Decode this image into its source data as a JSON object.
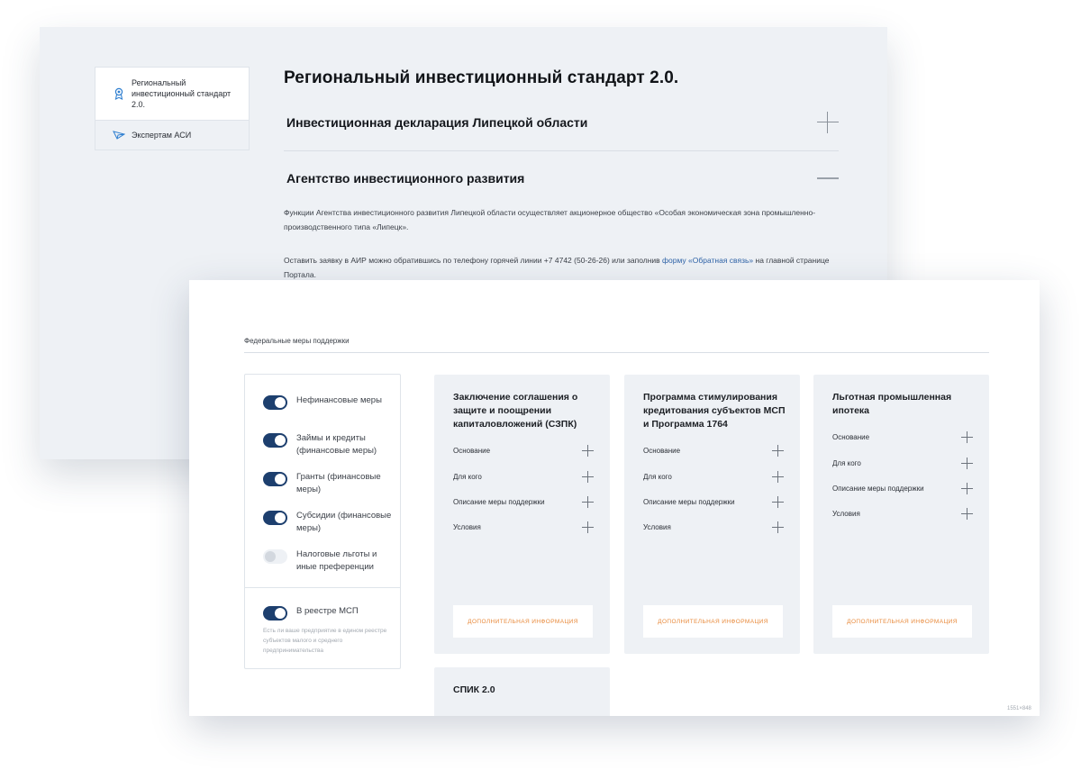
{
  "back_window": {
    "sidebar": {
      "items": [
        {
          "label": "Региональный инвестиционный стандарт 2.0.",
          "icon": "award-icon"
        },
        {
          "label": "Экспертам АСИ",
          "icon": "send-icon"
        }
      ]
    },
    "title": "Региональный инвестиционный стандарт 2.0.",
    "accordion": [
      {
        "label": "Инвестиционная декларация Липецкой области",
        "state": "collapsed"
      },
      {
        "label": "Агентство инвестиционного развития",
        "state": "expanded"
      }
    ],
    "paragraph1": "Функции Агентства инвестиционного развития Липецкой области осуществляет акционерное общество «Особая экономическая зона промышленно-производственного типа «Липецк».",
    "paragraph2": {
      "before": "Оставить заявку в АИР можно обратившись по телефону горячей линии +7 4742 (50-26-26) или заполнив ",
      "link": "форму «Обратная связь»",
      "after": " на главной странице Портала."
    }
  },
  "front_window": {
    "section_label": "Федеральные меры поддержки",
    "filters": [
      {
        "label": "Нефинансовые меры",
        "on": true
      },
      {
        "label": "Займы и кредиты (финансовые меры)",
        "on": true
      },
      {
        "label": "Гранты (финансовые меры)",
        "on": true
      },
      {
        "label": "Субсидии (финансовые меры)",
        "on": true
      },
      {
        "label": "Налоговые льготы и иные преференции",
        "on": false
      }
    ],
    "registry_filter": {
      "label": "В реестре МСП",
      "on": true
    },
    "registry_help": "Есть ли ваше предприятие в едином реестре субъектов малого и среднего предпринимательства",
    "cards": [
      {
        "title": "Заключение соглашения о защите и поощрении капиталовложений (СЗПК)",
        "rows": [
          "Основание",
          "Для кого",
          "Описание меры поддержки",
          "Условия"
        ],
        "button": "Дополнительная информация"
      },
      {
        "title": "Программа стимулирования кредитования субъектов МСП и Программа 1764",
        "rows": [
          "Основание",
          "Для кого",
          "Описание меры поддержки",
          "Условия"
        ],
        "button": "Дополнительная информация"
      },
      {
        "title": "Льготная промышленная ипотека",
        "rows": [
          "Основание",
          "Для кого",
          "Описание меры поддержки",
          "Условия"
        ],
        "button": "Дополнительная информация"
      },
      {
        "title": "СПИК 2.0"
      }
    ],
    "dimensions_note": "1551×848"
  },
  "colors": {
    "accent_dark": "#1d3f6e",
    "button_text": "#e8893a",
    "card_bg": "#eef1f5",
    "link": "#2f64a8"
  }
}
